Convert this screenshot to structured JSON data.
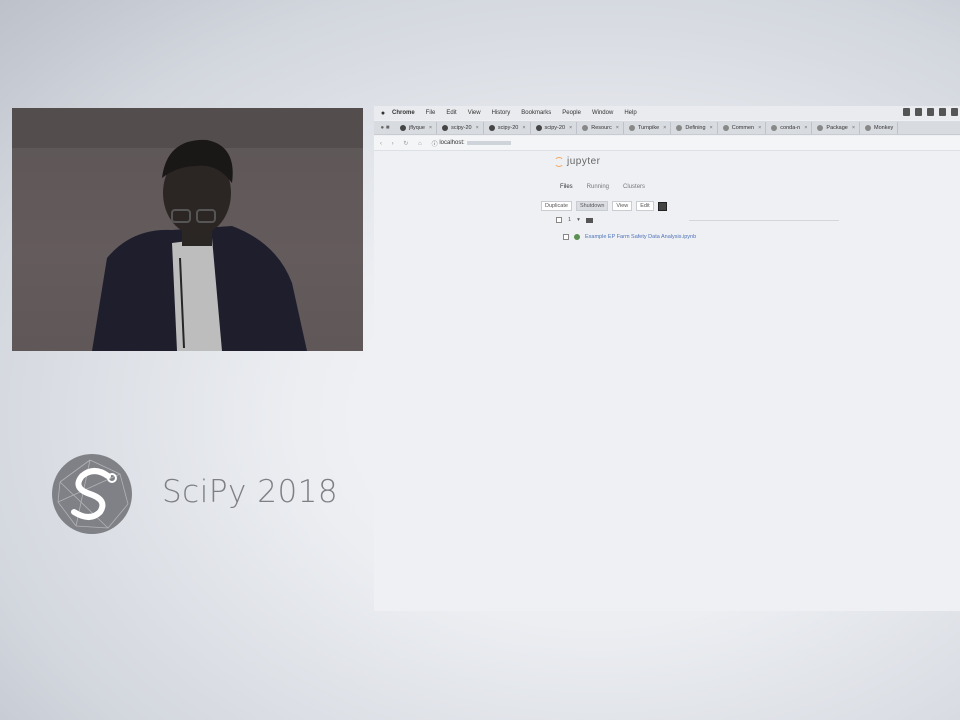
{
  "browser": {
    "menubar": {
      "apple_icon": "apple-icon",
      "items": [
        "Chrome",
        "File",
        "Edit",
        "View",
        "History",
        "Bookmarks",
        "People",
        "Window",
        "Help"
      ]
    },
    "tabs": [
      {
        "label": "jflyque",
        "icon": "github-icon"
      },
      {
        "label": "scipy-20",
        "icon": "github-icon"
      },
      {
        "label": "scipy-20",
        "icon": "github-icon"
      },
      {
        "label": "scipy-20",
        "icon": "github-icon"
      },
      {
        "label": "Resourc",
        "icon": "page-icon"
      },
      {
        "label": "Turnpike",
        "icon": "page-icon"
      },
      {
        "label": "Defining",
        "icon": "page-icon"
      },
      {
        "label": "Commen",
        "icon": "page-icon"
      },
      {
        "label": "conda-n",
        "icon": "page-icon"
      },
      {
        "label": "Package",
        "icon": "page-icon"
      },
      {
        "label": "Monkey",
        "icon": "page-icon"
      }
    ],
    "address": {
      "url": "localhost:"
    }
  },
  "jupyter": {
    "logo_text": "jupyter",
    "tabs": [
      "Files",
      "Running",
      "Clusters"
    ],
    "toolbar": {
      "duplicate": "Duplicate",
      "shutdown": "Shutdown",
      "view": "View",
      "edit": "Edit"
    },
    "file_header": {
      "count": "1",
      "caret": "▾"
    },
    "files": [
      {
        "name": "Example EP Farm Safety Data Analysis.ipynb"
      }
    ]
  },
  "branding": {
    "logo_text": "SciPy 2018"
  },
  "colors": {
    "jupyter_orange": "#f2a65a",
    "link": "#4f73b8",
    "logo_gray": "#7d7f85"
  }
}
